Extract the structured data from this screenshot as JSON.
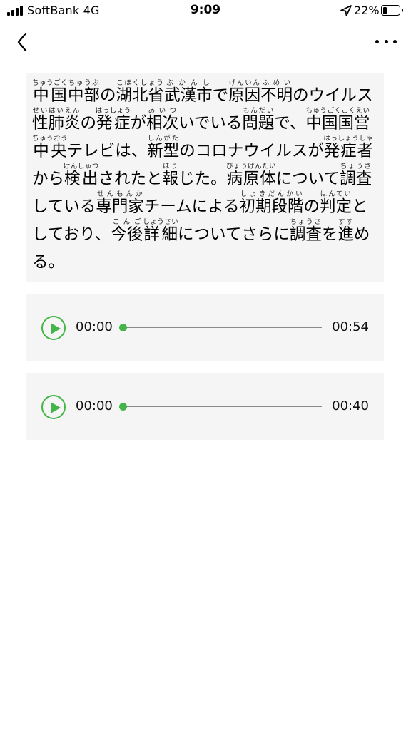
{
  "status_bar": {
    "carrier": "SoftBank  4G",
    "time": "9:09",
    "battery_percent": "22%",
    "battery_level": 0.22,
    "icons": [
      "signal-bars-icon",
      "location-arrow-icon",
      "battery-icon"
    ]
  },
  "nav": {
    "back_icon": "chevron-left-icon",
    "more_icon": "ellipsis-icon"
  },
  "article": {
    "text": "中国中部の湖北省武漢市で原因不明のウイルス性肺炎の発症が相次いでいる問題で、中国国営中央テレビは、新型のコロナウイルスが発症者から検出されたと報じた。病原体について調査している専門家チームによる初期段階の判定としており、今後詳細についてさらに調査を進める。",
    "segments": [
      {
        "t": "中国",
        "r": "ちゅうごく"
      },
      {
        "t": "中部",
        "r": "ちゅうぶ"
      },
      {
        "t": "の"
      },
      {
        "t": "湖北省",
        "r": "こほくしょう"
      },
      {
        "t": "武漢市",
        "r": "ぶかんし"
      },
      {
        "t": "で"
      },
      {
        "t": "原因",
        "r": "げんいん"
      },
      {
        "t": "不明",
        "r": "ふめい"
      },
      {
        "t": "のウイルス"
      },
      {
        "t": "性肺炎",
        "r": "せいはいえん"
      },
      {
        "t": "の"
      },
      {
        "t": "発症",
        "r": "はっしょう"
      },
      {
        "t": "が"
      },
      {
        "t": "相次",
        "r": "あいつ"
      },
      {
        "t": "いでいる"
      },
      {
        "t": "問題",
        "r": "もんだい"
      },
      {
        "t": "で、"
      },
      {
        "t": "中国国営",
        "r": "ちゅうごくこくえい"
      },
      {
        "t": "中央",
        "r": "ちゅうおう"
      },
      {
        "t": "テレビは、"
      },
      {
        "t": "新型",
        "r": "しんがた"
      },
      {
        "t": "のコロナウイルスが"
      },
      {
        "t": "発症者",
        "r": "はっしょうしゃ"
      },
      {
        "t": "から"
      },
      {
        "t": "検出",
        "r": "けんしゅつ"
      },
      {
        "t": "されたと"
      },
      {
        "t": "報",
        "r": "ほう"
      },
      {
        "t": "じた。"
      },
      {
        "t": "病原体",
        "r": "びょうげんたい"
      },
      {
        "t": "について"
      },
      {
        "t": "調査",
        "r": "ちょうさ"
      },
      {
        "t": "している"
      },
      {
        "t": "専門家",
        "r": "せんもんか"
      },
      {
        "t": "チームによる"
      },
      {
        "t": "初期段階",
        "r": "しょきだんかい"
      },
      {
        "t": "の"
      },
      {
        "t": "判定",
        "r": "はんてい"
      },
      {
        "t": "としており、"
      },
      {
        "t": "今後",
        "r": "こんご"
      },
      {
        "t": "詳細",
        "r": "しょうさい"
      },
      {
        "t": "についてさらに"
      },
      {
        "t": "調査",
        "r": "ちょうさ"
      },
      {
        "t": "を"
      },
      {
        "t": "進",
        "r": "すす"
      },
      {
        "t": "める。"
      }
    ]
  },
  "players": [
    {
      "current": "00:00",
      "duration": "00:54",
      "progress": 0.0,
      "play_icon": "play-icon"
    },
    {
      "current": "00:00",
      "duration": "00:40",
      "progress": 0.0,
      "play_icon": "play-icon"
    }
  ],
  "colors": {
    "accent": "#44b549",
    "card_bg": "#f5f5f5",
    "track": "#8a8a8a"
  }
}
